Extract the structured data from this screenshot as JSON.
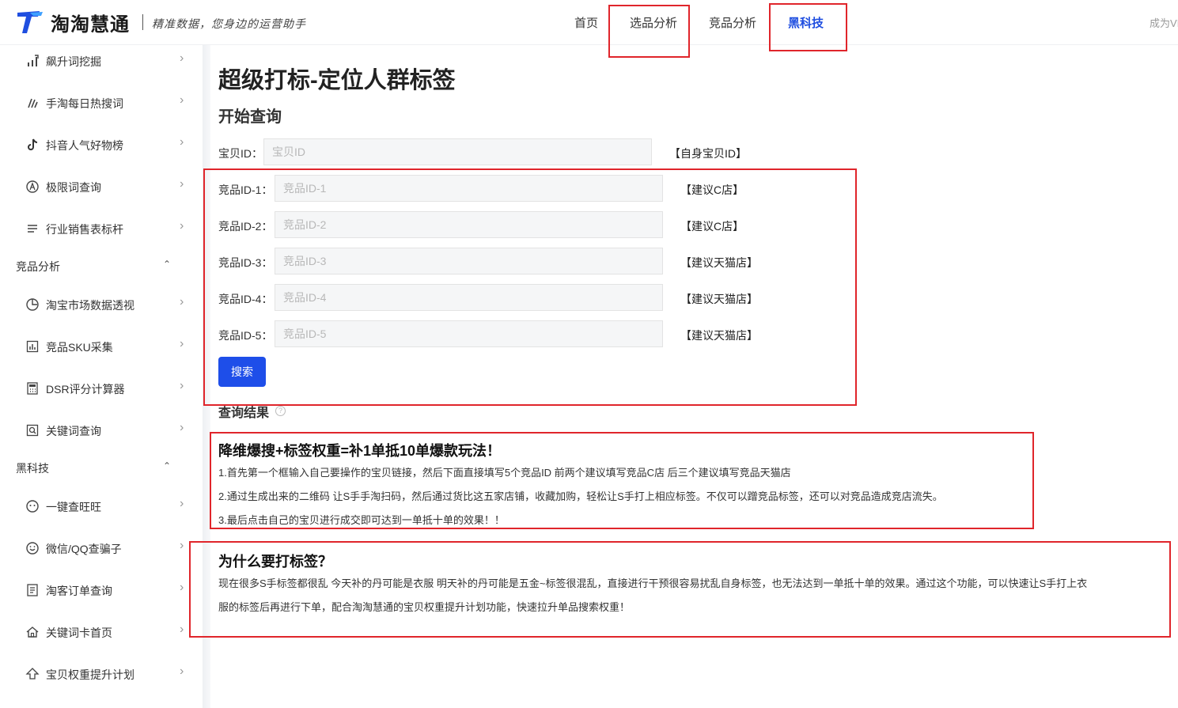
{
  "header": {
    "brand": "淘淘慧通",
    "slogan": "精准数据，您身边的运营助手",
    "nav": [
      {
        "label": "首页"
      },
      {
        "label": "选品分析"
      },
      {
        "label": "竞品分析"
      },
      {
        "label": "黑科技",
        "active": true
      }
    ],
    "right_text": "成为VIP",
    "accent_color": "#1f4ee0"
  },
  "sidebar": {
    "items_top": [
      {
        "label": "飙升词挖掘",
        "icon": "trend-bars-icon"
      },
      {
        "label": "手淘每日热搜词",
        "icon": "flame-icon"
      },
      {
        "label": "抖音人气好物榜",
        "icon": "tiktok-icon"
      },
      {
        "label": "极限词查询",
        "icon": "circle-a-icon"
      },
      {
        "label": "行业销售表标杆",
        "icon": "list-icon"
      }
    ],
    "group_compete": {
      "label": "竞品分析"
    },
    "items_compete": [
      {
        "label": "淘宝市场数据透视",
        "icon": "pie-chart-icon"
      },
      {
        "label": "竞品SKU采集",
        "icon": "bar-chart-icon"
      },
      {
        "label": "DSR评分计算器",
        "icon": "calculator-icon"
      },
      {
        "label": "关键词查询",
        "icon": "search-doc-icon"
      }
    ],
    "group_tech": {
      "label": "黑科技"
    },
    "items_tech": [
      {
        "label": "一键查旺旺",
        "icon": "smile-icon"
      },
      {
        "label": "微信/QQ查骗子",
        "icon": "smile-icon"
      },
      {
        "label": "淘客订单查询",
        "icon": "document-icon"
      },
      {
        "label": "关键词卡首页",
        "icon": "home-icon"
      },
      {
        "label": "宝贝权重提升计划",
        "icon": "arrow-up-icon"
      }
    ]
  },
  "main": {
    "title": "超级打标-定位人群标签",
    "section": "开始查询",
    "own_id": {
      "label": "宝贝ID：",
      "placeholder": "宝贝ID",
      "hint": "【自身宝贝ID】"
    },
    "competitors": [
      {
        "label": "竞品ID-1：",
        "placeholder": "竞品ID-1",
        "hint": "【建议C店】"
      },
      {
        "label": "竞品ID-2：",
        "placeholder": "竞品ID-2",
        "hint": "【建议C店】"
      },
      {
        "label": "竞品ID-3：",
        "placeholder": "竞品ID-3",
        "hint": "【建议天猫店】"
      },
      {
        "label": "竞品ID-4：",
        "placeholder": "竞品ID-4",
        "hint": "【建议天猫店】"
      },
      {
        "label": "竞品ID-5：",
        "placeholder": "竞品ID-5",
        "hint": "【建议天猫店】"
      }
    ],
    "search_button": "搜索",
    "result_title": "查询结果",
    "tips": {
      "heading": "降维爆搜+标签权重=补1单抵10单爆款玩法！",
      "lines": [
        "1.首先第一个框输入自己要操作的宝贝链接，然后下面直接填写5个竞品ID 前两个建议填写竞品C店 后三个建议填写竞品天猫店",
        "2.通过生成出来的二维码 让S手手淘扫码，然后通过货比这五家店铺，收藏加购，轻松让S手打上相应标签。不仅可以蹭竞品标签，还可以对竞品造成竞店流失。",
        "3.最后点击自己的宝贝进行成交即可达到一单抵十单的效果！！"
      ]
    },
    "why": {
      "heading": "为什么要打标签？",
      "lines": [
        "现在很多S手标签都很乱 今天补的丹可能是衣服 明天补的丹可能是五金~标签很混乱，直接进行干预很容易扰乱自身标签，也无法达到一单抵十单的效果。通过这个功能，可以快速让S手打上衣",
        "服的标签后再进行下单，配合淘淘慧通的宝贝权重提升计划功能，快速拉升单品搜索权重！"
      ]
    },
    "annotation_color": "#e0252b"
  }
}
